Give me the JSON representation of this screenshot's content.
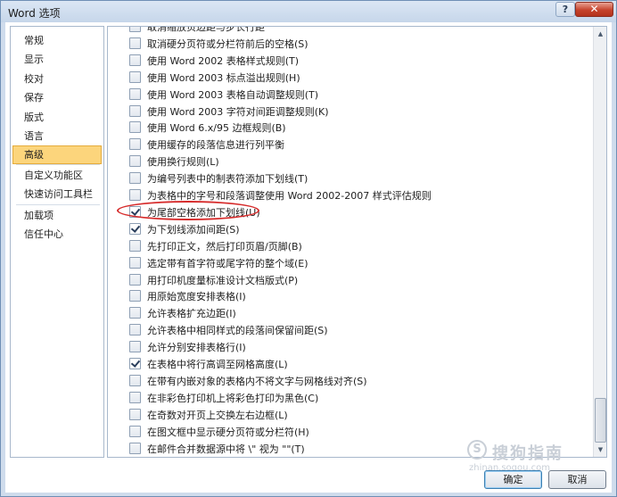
{
  "window": {
    "title": "Word 选项",
    "help_glyph": "?",
    "close_glyph": "✕"
  },
  "sidebar": {
    "items": [
      {
        "label": "常规",
        "selected": false
      },
      {
        "label": "显示",
        "selected": false
      },
      {
        "label": "校对",
        "selected": false
      },
      {
        "label": "保存",
        "selected": false
      },
      {
        "label": "版式",
        "selected": false
      },
      {
        "label": "语言",
        "selected": false
      },
      {
        "label": "高级",
        "selected": true
      },
      {
        "label": "自定义功能区",
        "selected": false
      },
      {
        "label": "快速访问工具栏",
        "selected": false
      },
      {
        "label": "加载项",
        "selected": false
      },
      {
        "label": "信任中心",
        "selected": false
      }
    ]
  },
  "options": [
    {
      "label": "取消缩放页边距与步长行距",
      "checked": false
    },
    {
      "label": "取消硬分页符或分栏符前后的空格(S)",
      "checked": false
    },
    {
      "label": "使用 Word 2002 表格样式规则(T)",
      "checked": false
    },
    {
      "label": "使用 Word 2003 标点溢出规则(H)",
      "checked": false
    },
    {
      "label": "使用 Word 2003 表格自动调整规则(T)",
      "checked": false
    },
    {
      "label": "使用 Word 2003 字符对间距调整规则(K)",
      "checked": false
    },
    {
      "label": "使用 Word 6.x/95 边框规则(B)",
      "checked": false
    },
    {
      "label": "使用缓存的段落信息进行列平衡",
      "checked": false
    },
    {
      "label": "使用换行规则(L)",
      "checked": false
    },
    {
      "label": "为编号列表中的制表符添加下划线(T)",
      "checked": false
    },
    {
      "label": "为表格中的字号和段落调整使用 Word 2002-2007 样式评估规则",
      "checked": false
    },
    {
      "label": "为尾部空格添加下划线(U)",
      "checked": true
    },
    {
      "label": "为下划线添加间距(S)",
      "checked": true
    },
    {
      "label": "先打印正文，然后打印页眉/页脚(B)",
      "checked": false
    },
    {
      "label": "选定带有首字符或尾字符的整个域(E)",
      "checked": false
    },
    {
      "label": "用打印机度量标准设计文档版式(P)",
      "checked": false
    },
    {
      "label": "用原始宽度安排表格(I)",
      "checked": false
    },
    {
      "label": "允许表格扩充边距(I)",
      "checked": false
    },
    {
      "label": "允许表格中相同样式的段落间保留间距(S)",
      "checked": false
    },
    {
      "label": "允许分别安排表格行(I)",
      "checked": false
    },
    {
      "label": "在表格中将行高调至网格高度(L)",
      "checked": true
    },
    {
      "label": "在带有内嵌对象的表格内不将文字与网格线对齐(S)",
      "checked": false
    },
    {
      "label": "在非彩色打印机上将彩色打印为黑色(C)",
      "checked": false
    },
    {
      "label": "在奇数对开页上交换左右边框(L)",
      "checked": false
    },
    {
      "label": "在图文框中显示硬分页符或分栏符(H)",
      "checked": false
    },
    {
      "label": "在邮件合并数据源中将 \\\" 视为 \"\"(T)",
      "checked": false
    }
  ],
  "scrollbar": {
    "up_glyph": "▲",
    "down_glyph": "▼"
  },
  "watermark": {
    "logo": "S",
    "text": "搜狗指南",
    "url": "zhinan.sogou.com"
  },
  "buttons": {
    "ok_label": "确定",
    "cancel_label": "取消"
  }
}
